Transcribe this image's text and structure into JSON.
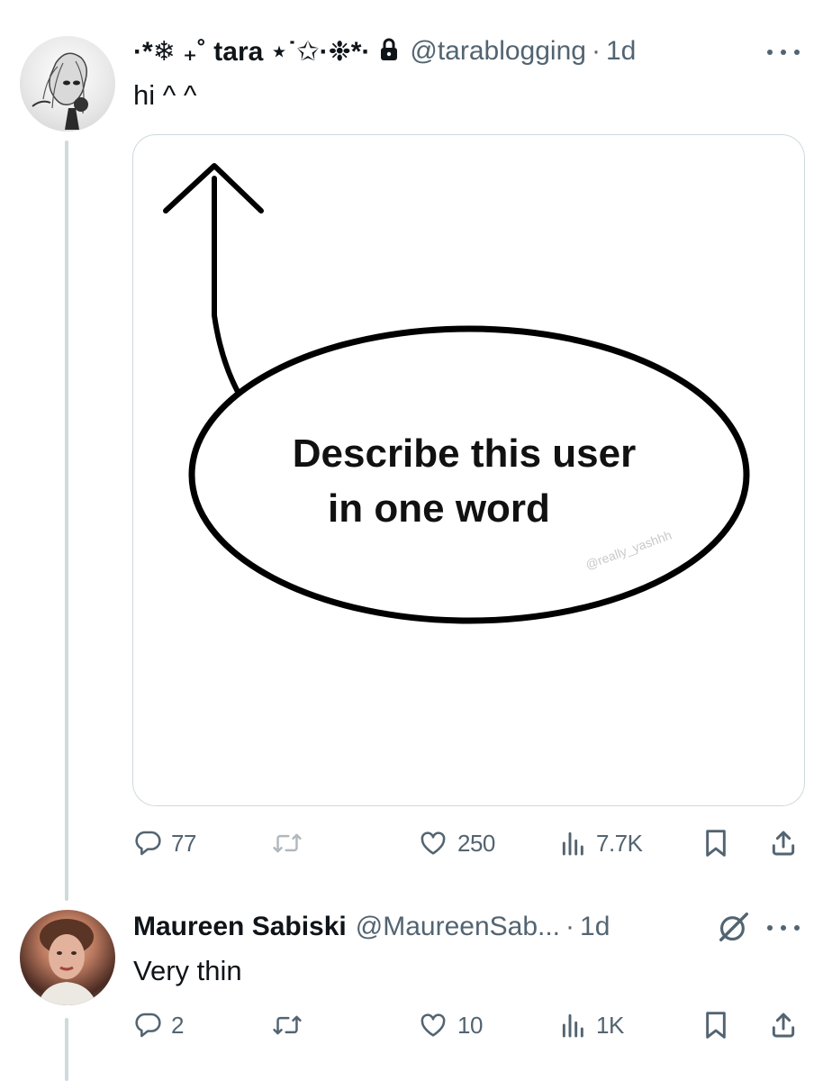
{
  "tweet1": {
    "display_name": "·*❄︎ ₊˚ tara ⋆˙✩·❉*·",
    "handle": "@tarablogging",
    "time": "1d",
    "text": "hi ^ ^",
    "media": {
      "line1": "Describe this user",
      "line2": "in one word",
      "watermark": "@really_yashhh"
    },
    "stats": {
      "replies": "77",
      "likes": "250",
      "views": "7.7K"
    }
  },
  "tweet2": {
    "display_name": "Maureen Sabiski",
    "handle": "@MaureenSab...",
    "time": "1d",
    "text": "Very thin",
    "stats": {
      "replies": "2",
      "likes": "10",
      "views": "1K"
    }
  },
  "colors": {
    "secondary_text": "#536471",
    "thread_line": "#cfd9de",
    "border": "#cfd9de"
  },
  "icons": [
    "lock-icon",
    "more-icon",
    "reply-icon",
    "retweet-icon",
    "like-icon",
    "views-icon",
    "bookmark-icon",
    "share-icon",
    "grok-icon"
  ]
}
